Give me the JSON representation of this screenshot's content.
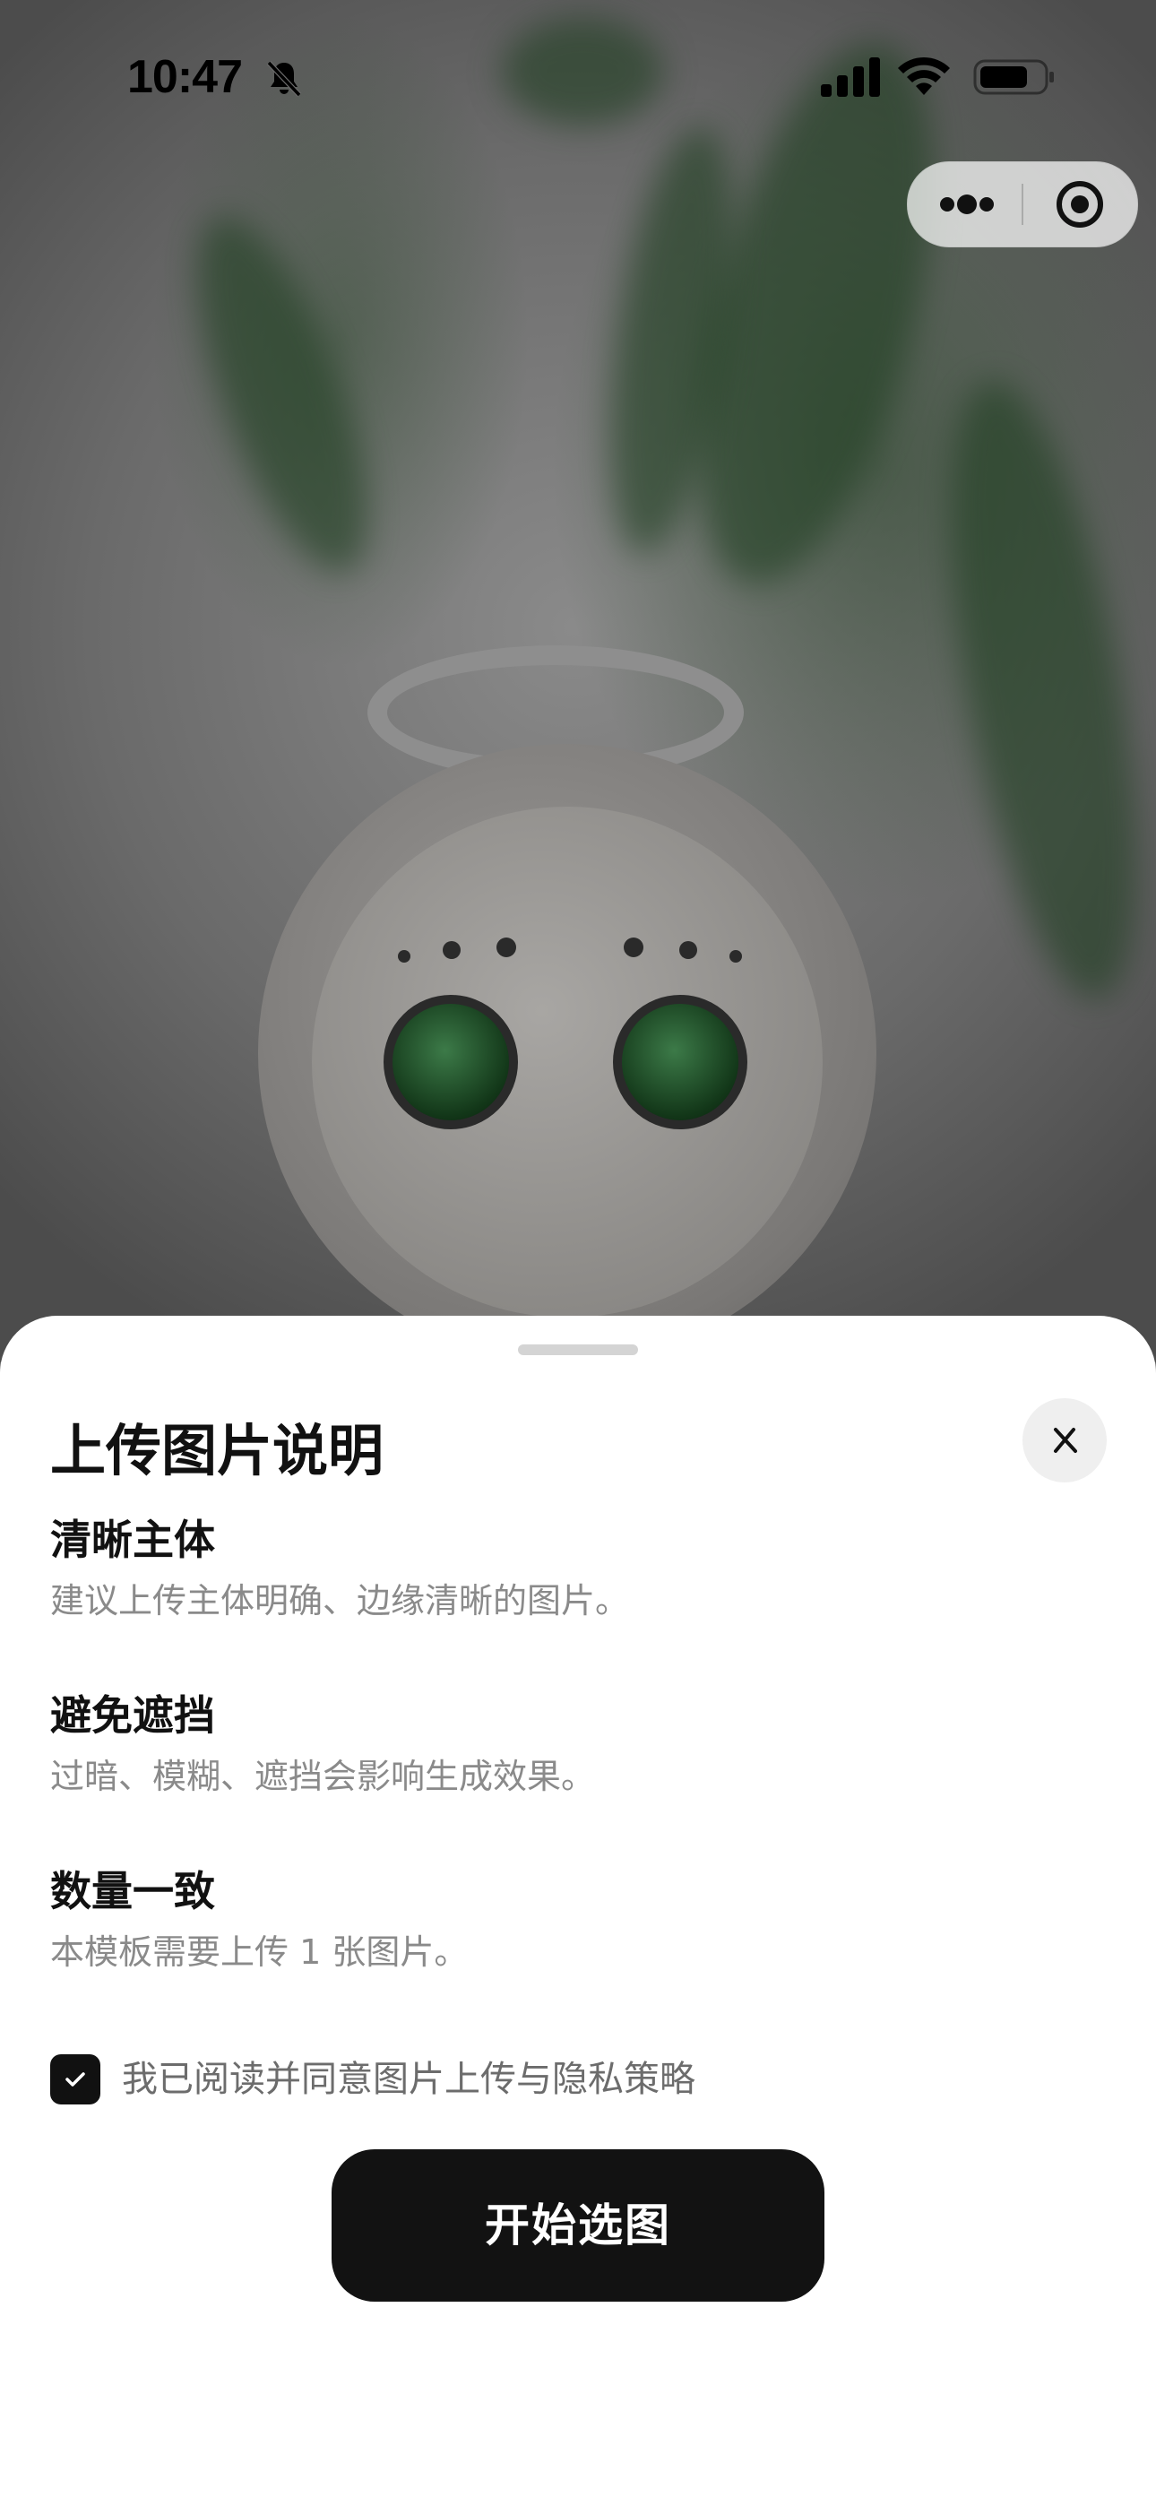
{
  "status_bar": {
    "time": "10:47",
    "silent_icon": "bell-slash-icon",
    "signal_icon": "cellular-signal-icon",
    "wifi_icon": "wifi-icon",
    "battery_icon": "battery-icon"
  },
  "capsule": {
    "more_icon": "more-dots-icon",
    "close_icon": "record-target-icon"
  },
  "sheet": {
    "title": "上传图片说明",
    "close_icon": "close-icon",
    "sections": [
      {
        "heading": "清晰主体",
        "text": "建议上传主体明确、边缘清晰的图片。"
      },
      {
        "heading": "避免遮挡",
        "text": "过暗、模糊、遮挡会影响生成效果。"
      },
      {
        "heading": "数量一致",
        "text": "本模板需要上传 1 张图片。"
      }
    ],
    "agreement": {
      "checked": true,
      "label": "我已阅读并同意图片上传与隐私策略"
    },
    "primary_button": "开始选图"
  },
  "colors": {
    "sheet_bg": "#ffffff",
    "button_bg": "#121212",
    "secondary_text": "#8a8a8a"
  }
}
